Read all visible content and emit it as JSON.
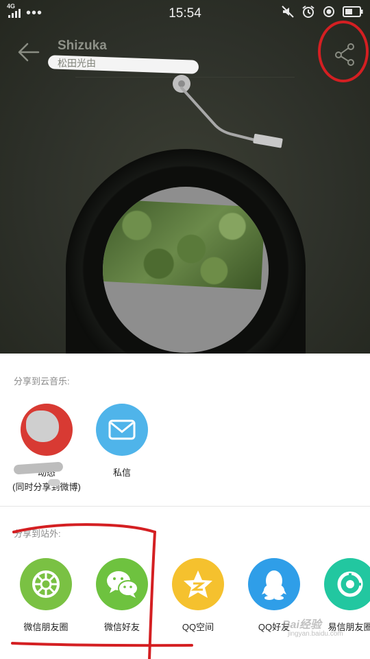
{
  "status_bar": {
    "network": "4G",
    "time": "15:54"
  },
  "header": {
    "song_title": "Shizuka",
    "artist": "松田光由"
  },
  "share_sheet": {
    "section_cloud_title": "分享到云音乐:",
    "cloud_items": [
      {
        "label": "动态",
        "sub_label": "(同时分享到微博)",
        "icon": "dynamic-icon",
        "color": "#d83a33"
      },
      {
        "label": "私信",
        "icon": "mail-icon",
        "color": "#4fb4ea"
      }
    ],
    "section_external_title": "分享到站外:",
    "external_items": [
      {
        "label": "微信朋友圈",
        "icon": "wechat-moments-icon",
        "color": "#7ac143"
      },
      {
        "label": "微信好友",
        "icon": "wechat-icon",
        "color": "#6ec23f"
      },
      {
        "label": "QQ空间",
        "icon": "qzone-icon",
        "color": "#f5c12e"
      },
      {
        "label": "QQ好友",
        "icon": "qq-icon",
        "color": "#2f9ee8"
      },
      {
        "label": "易信朋友圈",
        "icon": "yixin-moments-icon",
        "color": "#22c7a0"
      }
    ]
  },
  "watermark": {
    "brand": "Bai经验",
    "url": "jingyan.baidu.com"
  }
}
